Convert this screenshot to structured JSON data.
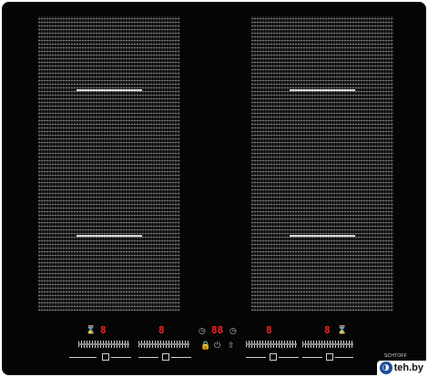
{
  "brand": "SCHTOFF",
  "watermark": "teh.by",
  "zones": [
    {
      "level": "8"
    },
    {
      "level": "8"
    },
    {
      "level": "8"
    },
    {
      "level": "8"
    }
  ],
  "timer": {
    "value": "88"
  },
  "icons": {
    "zone": "pan-icon",
    "lock": "lock-icon",
    "power": "power-icon",
    "timer": "clock-icon",
    "booster": "booster-icon",
    "pause": "pause-icon"
  },
  "colors": {
    "display": "#ff2222",
    "glass": "#050505",
    "logo": "#1b4f9a"
  }
}
